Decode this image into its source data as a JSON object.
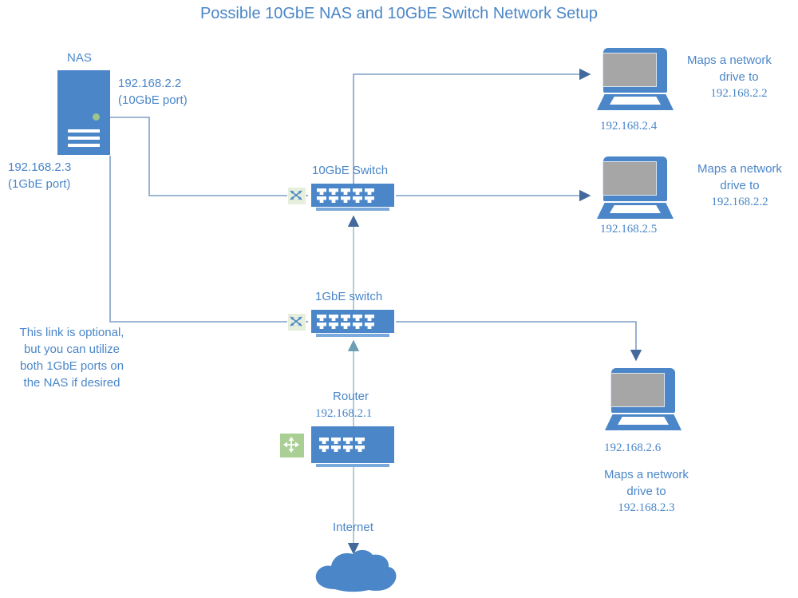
{
  "title": "Possible 10GbE NAS and 10GbE Switch Network Setup",
  "colors": {
    "accent_blue": "#4a86c8",
    "device_blue": "#4a86c8",
    "screen_gray": "#a6a6a6",
    "led_green": "#9dc48a",
    "panel_green": "#a9cf95",
    "link_line": "#7f9fc4",
    "text_blue": "#4a86c8"
  },
  "nas": {
    "name": "NAS",
    "port_10gbe_label": "192.168.2.2\n(10GbE port)",
    "port_1gbe_label": "192.168.2.3\n(1GbE port)"
  },
  "switches": {
    "ten_gbe": {
      "label": "10GbE Switch",
      "ports": 10,
      "panel_icon": "crossing-arrows-icon"
    },
    "one_gbe": {
      "label": "1GbE switch",
      "ports": 10,
      "panel_icon": "crossing-arrows-icon"
    }
  },
  "router": {
    "label": "Router",
    "ip": "192.168.2.1",
    "ports": 8,
    "panel_icon": "four-way-arrows-icon"
  },
  "internet": {
    "label": "Internet",
    "icon": "cloud-icon"
  },
  "note": {
    "optional_link": "This link is optional, but you can utilize both 1GbE ports on the NAS if desired"
  },
  "clients": [
    {
      "id": "client-2-4",
      "ip": "192.168.2.4",
      "maps_line1": "Maps a network",
      "maps_line2": "drive to",
      "maps_line3": "192.168.2.2"
    },
    {
      "id": "client-2-5",
      "ip": "192.168.2.5",
      "maps_line1": "Maps a network",
      "maps_line2": "drive to",
      "maps_line3": "192.168.2.2"
    },
    {
      "id": "client-2-6",
      "ip": "192.168.2.6",
      "maps_line1": "Maps a network",
      "maps_line2": "drive to",
      "maps_line3": "192.168.2.3"
    }
  ]
}
